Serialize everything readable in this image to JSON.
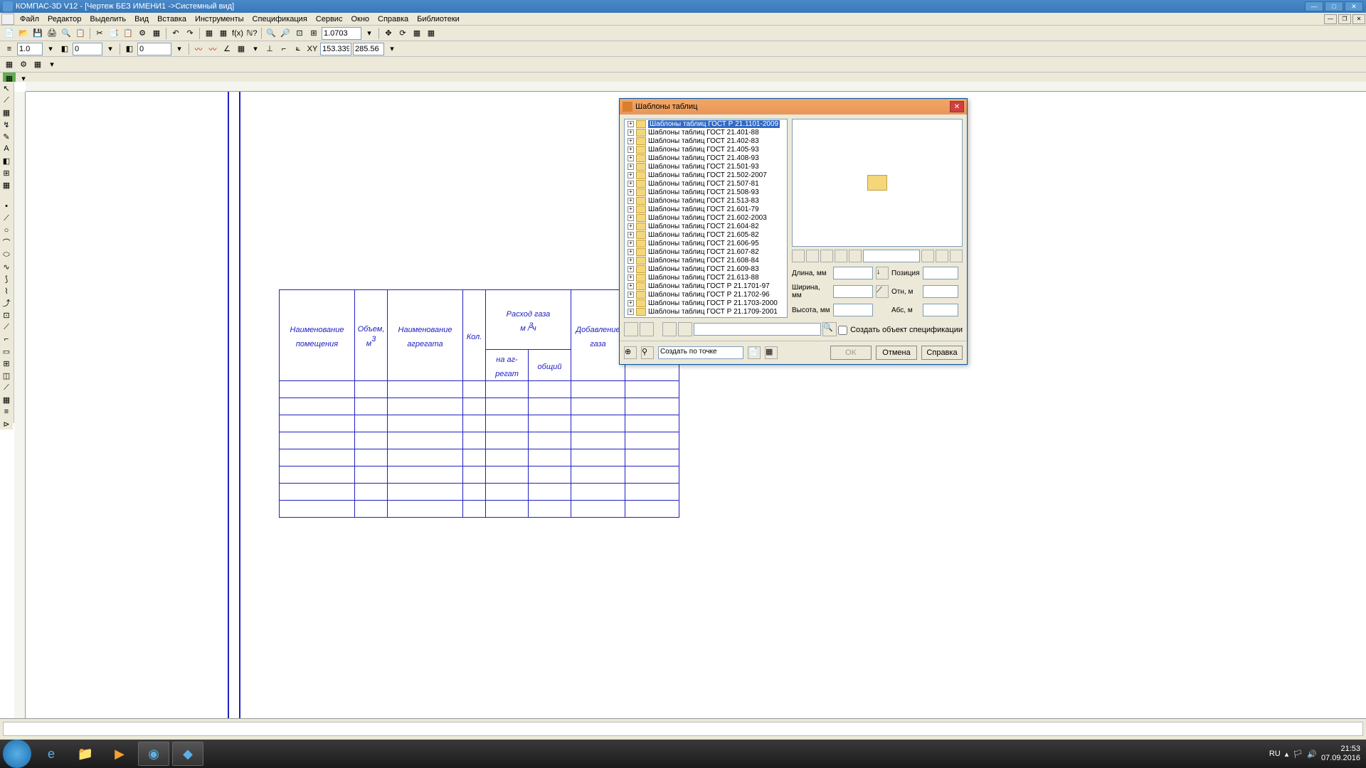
{
  "title": "КОМПАС-3D V12 - [Чертеж БЕЗ ИМЕНИ1 ->Системный вид]",
  "menu": [
    "Файл",
    "Редактор",
    "Выделить",
    "Вид",
    "Вставка",
    "Инструменты",
    "Спецификация",
    "Сервис",
    "Окно",
    "Справка",
    "Библиотеки"
  ],
  "toolbar2": {
    "linewidth": "1.0",
    "num1": "0",
    "num2": "0",
    "zoom": "1.0703",
    "coord_x": "153.339",
    "coord_y": "285.56"
  },
  "table": {
    "h1": "Наименование помещения",
    "h2_l1": "Объем,",
    "h2_l2": "м",
    "h2_sup": "3",
    "h3": "Наименование агрегата",
    "h4": "Кол.",
    "h5_top_l1": "Расход газа",
    "h5_top_l2": "м  / ч",
    "h5_sup": "3",
    "h5a": "на аг-регат",
    "h5b": "общий",
    "h6": "Добавление газа"
  },
  "dialog": {
    "title": "Шаблоны таблиц",
    "tree": [
      "Шаблоны таблиц ГОСТ Р 21.1101-2009",
      "Шаблоны таблиц ГОСТ 21.401-88",
      "Шаблоны таблиц ГОСТ 21.402-83",
      "Шаблоны таблиц ГОСТ 21.405-93",
      "Шаблоны таблиц ГОСТ 21.408-93",
      "Шаблоны таблиц ГОСТ 21.501-93",
      "Шаблоны таблиц ГОСТ 21.502-2007",
      "Шаблоны таблиц ГОСТ 21.507-81",
      "Шаблоны таблиц ГОСТ 21.508-93",
      "Шаблоны таблиц ГОСТ 21.513-83",
      "Шаблоны таблиц ГОСТ 21.601-79",
      "Шаблоны таблиц ГОСТ 21.602-2003",
      "Шаблоны таблиц ГОСТ 21.604-82",
      "Шаблоны таблиц ГОСТ 21.605-82",
      "Шаблоны таблиц ГОСТ 21.606-95",
      "Шаблоны таблиц ГОСТ 21.607-82",
      "Шаблоны таблиц ГОСТ 21.608-84",
      "Шаблоны таблиц ГОСТ 21.609-83",
      "Шаблоны таблиц ГОСТ 21.613-88",
      "Шаблоны таблиц ГОСТ Р 21.1701-97",
      "Шаблоны таблиц ГОСТ Р 21.1702-96",
      "Шаблоны таблиц ГОСТ Р 21.1703-2000",
      "Шаблоны таблиц ГОСТ Р 21.1709-2001"
    ],
    "fields": {
      "dlina": "Длина, мм",
      "shirina": "Ширина, мм",
      "visota": "Высота, мм",
      "poziciya": "Позиция",
      "otn": "Отн, м",
      "abs": "Абс, м"
    },
    "chk": "Создать объект спецификации",
    "create_mode": "Создать по точке",
    "ok": "OK",
    "cancel": "Отмена",
    "help": "Справка"
  },
  "tray": {
    "lang": "RU",
    "time": "21:53",
    "date": "07.09.2016"
  }
}
